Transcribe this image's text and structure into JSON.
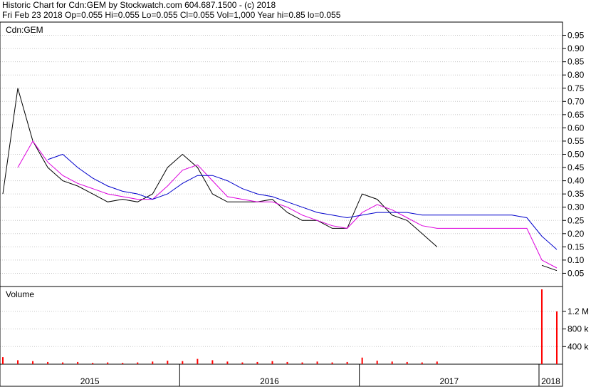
{
  "header": {
    "line1": "Historic Chart for Cdn:GEM by Stockwatch.com 604.687.1500 - (c) 2018",
    "line2": "Fri Feb 23 2018  Op=0.055  Hi=0.055  Lo=0.055  Cl=0.055  Vol=1,000  Year hi=0.85  lo=0.055"
  },
  "chart_data": {
    "type": "line",
    "title": "Cdn:GEM",
    "price_panel": {
      "ticker_label": "Cdn:GEM",
      "ylim": [
        0,
        1.0
      ],
      "y_ticks": [
        "0.95",
        "0.90",
        "0.85",
        "0.80",
        "0.75",
        "0.70",
        "0.65",
        "0.60",
        "0.55",
        "0.50",
        "0.45",
        "0.40",
        "0.35",
        "0.30",
        "0.25",
        "0.20",
        "0.15",
        "0.10",
        "0.05"
      ],
      "grid": true,
      "x": [
        "2015-01",
        "2015-02",
        "2015-03",
        "2015-04",
        "2015-05",
        "2015-06",
        "2015-07",
        "2015-08",
        "2015-09",
        "2015-10",
        "2015-11",
        "2015-12",
        "2016-01",
        "2016-02",
        "2016-03",
        "2016-04",
        "2016-05",
        "2016-06",
        "2016-07",
        "2016-08",
        "2016-09",
        "2016-10",
        "2016-11",
        "2016-12",
        "2017-01",
        "2017-02",
        "2017-03",
        "2017-04",
        "2017-05",
        "2017-06",
        "2017-07",
        "2017-08",
        "2017-09",
        "2017-10",
        "2017-11",
        "2017-12",
        "2018-01",
        "2018-02"
      ],
      "series": [
        {
          "color": "#000000",
          "values": [
            0.35,
            0.75,
            0.55,
            0.45,
            0.4,
            0.38,
            0.35,
            0.32,
            0.33,
            0.32,
            0.35,
            0.45,
            0.5,
            0.45,
            0.35,
            0.32,
            0.32,
            0.32,
            0.33,
            0.28,
            0.25,
            0.25,
            0.22,
            0.22,
            0.35,
            0.33,
            0.27,
            0.25,
            0.2,
            0.15,
            null,
            null,
            null,
            null,
            null,
            null,
            0.08,
            0.06
          ]
        },
        {
          "color": "#dd00dd",
          "values": [
            null,
            0.45,
            0.55,
            0.47,
            0.42,
            0.39,
            0.37,
            0.35,
            0.34,
            0.33,
            0.33,
            0.38,
            0.44,
            0.46,
            0.4,
            0.34,
            0.33,
            0.32,
            0.32,
            0.3,
            0.27,
            0.25,
            0.23,
            0.22,
            0.28,
            0.31,
            0.29,
            0.26,
            0.23,
            0.22,
            0.22,
            0.22,
            0.22,
            0.22,
            0.22,
            0.22,
            0.1,
            0.07
          ]
        },
        {
          "color": "#0000cc",
          "values": [
            null,
            null,
            null,
            0.48,
            0.5,
            0.45,
            0.41,
            0.38,
            0.36,
            0.35,
            0.33,
            0.35,
            0.39,
            0.42,
            0.42,
            0.4,
            0.37,
            0.35,
            0.34,
            0.32,
            0.3,
            0.28,
            0.27,
            0.26,
            0.27,
            0.28,
            0.28,
            0.28,
            0.27,
            0.27,
            0.27,
            0.27,
            0.27,
            0.27,
            0.27,
            0.26,
            0.19,
            0.14
          ]
        }
      ]
    },
    "volume_panel": {
      "label": "Volume",
      "ylim": [
        0,
        1700000
      ],
      "y_ticks": [
        {
          "label": "1.2 M",
          "value": 1200000
        },
        {
          "label": "800 k",
          "value": 800000
        },
        {
          "label": "400 k",
          "value": 400000
        }
      ],
      "x": [
        "2015-01",
        "2015-02",
        "2015-03",
        "2015-04",
        "2015-05",
        "2015-06",
        "2015-07",
        "2015-08",
        "2015-09",
        "2015-10",
        "2015-11",
        "2015-12",
        "2016-01",
        "2016-02",
        "2016-03",
        "2016-04",
        "2016-05",
        "2016-06",
        "2016-07",
        "2016-08",
        "2016-09",
        "2016-10",
        "2016-11",
        "2016-12",
        "2017-01",
        "2017-02",
        "2017-03",
        "2017-04",
        "2017-05",
        "2017-06",
        "2017-07",
        "2017-08",
        "2017-09",
        "2017-10",
        "2017-11",
        "2017-12",
        "2018-01",
        "2018-02"
      ],
      "values": [
        160000,
        90000,
        70000,
        50000,
        40000,
        50000,
        30000,
        40000,
        30000,
        40000,
        60000,
        80000,
        70000,
        120000,
        90000,
        60000,
        40000,
        50000,
        70000,
        50000,
        40000,
        60000,
        40000,
        50000,
        150000,
        80000,
        60000,
        50000,
        40000,
        60000,
        0,
        0,
        0,
        0,
        0,
        0,
        1700000,
        1200000
      ]
    },
    "x_axis": {
      "labels": [
        "2015",
        "2016",
        "2017",
        "2018"
      ]
    }
  }
}
